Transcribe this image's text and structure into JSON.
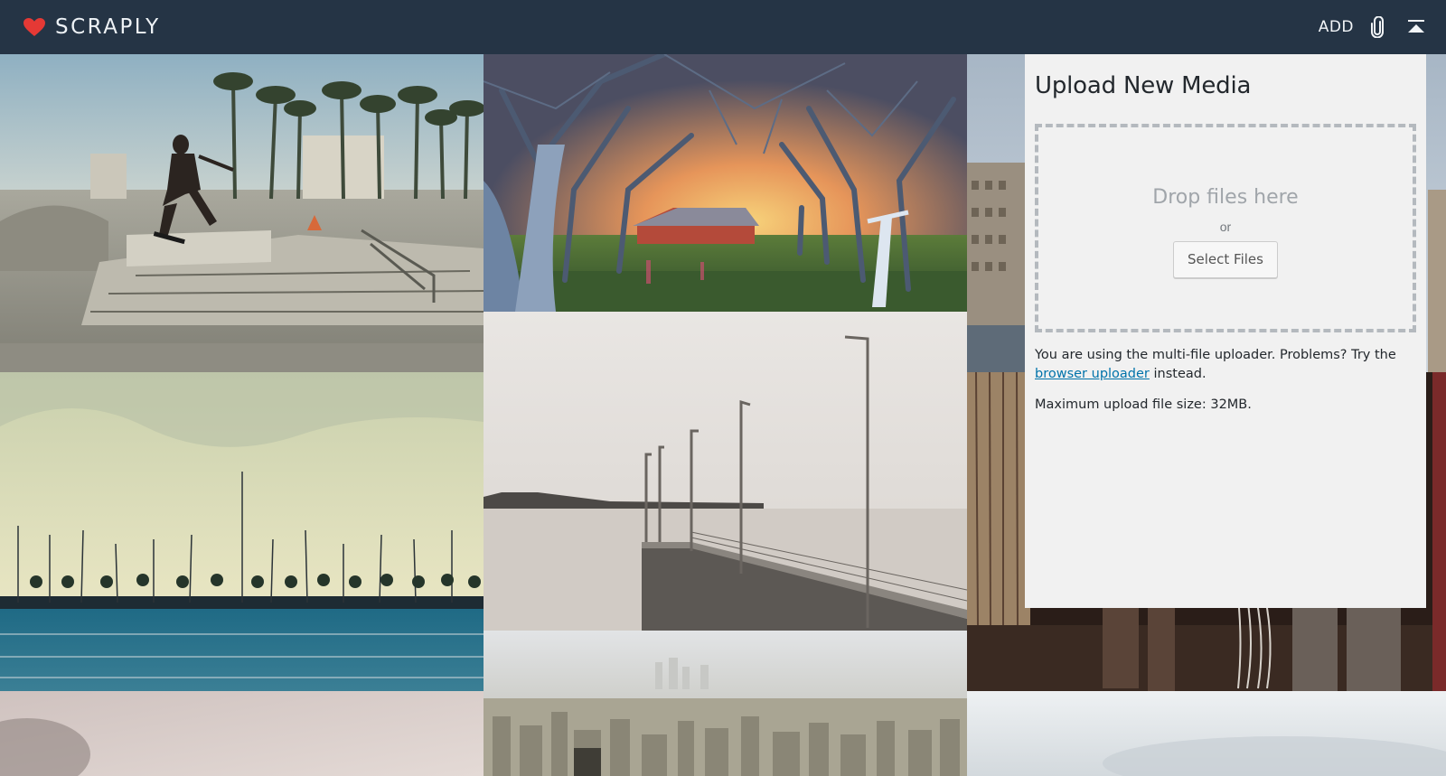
{
  "header": {
    "brand": "SCRAPLY",
    "brand_color": "#e53935",
    "bar_color": "#253445",
    "nav": {
      "add_label": "ADD",
      "attach_icon": "paperclip-icon",
      "collapse_icon": "eject-collapse-icon"
    }
  },
  "gallery": {
    "tiles": [
      {
        "name": "skatepark-photo"
      },
      {
        "name": "orchard-sunset-photo"
      },
      {
        "name": "city-rooftops-photo"
      },
      {
        "name": "harbor-sailboats-photo"
      },
      {
        "name": "pier-streetlights-photo"
      },
      {
        "name": "hanging-garments-photo"
      },
      {
        "name": "misty-pink-photo"
      },
      {
        "name": "city-skyline-aerial-photo"
      },
      {
        "name": "cloudy-sky-photo"
      }
    ]
  },
  "upload": {
    "title": "Upload New Media",
    "drop_text": "Drop files here",
    "or_text": "or",
    "select_button": "Select Files",
    "info_before": "You are using the multi-file uploader. Problems? Try the",
    "info_link": "browser uploader",
    "info_after": " instead.",
    "max_size": "Maximum upload file size: 32MB."
  }
}
